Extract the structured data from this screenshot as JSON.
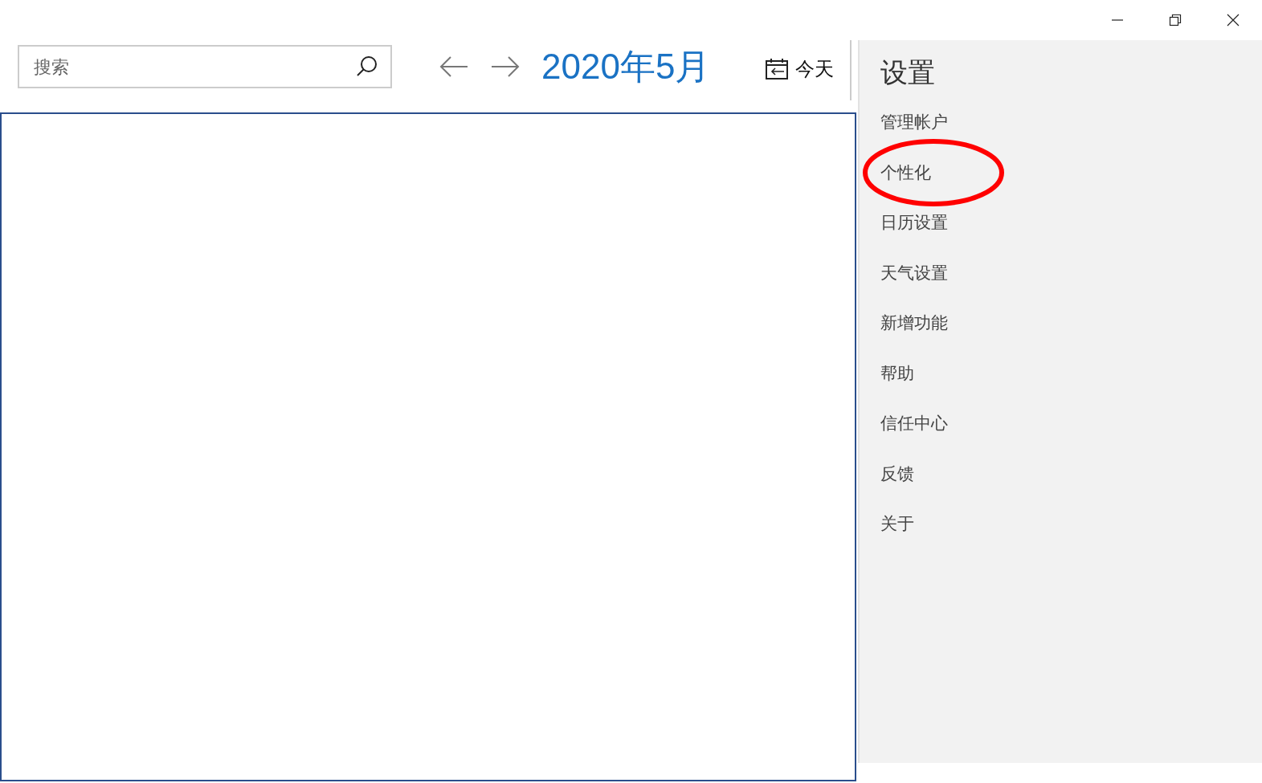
{
  "search": {
    "placeholder": "搜索"
  },
  "header": {
    "month": "2020年5月",
    "today": "今天"
  },
  "settings": {
    "title": "设置",
    "items": [
      {
        "label": "管理帐户",
        "circled": false
      },
      {
        "label": "个性化",
        "circled": true
      },
      {
        "label": "日历设置",
        "circled": false
      },
      {
        "label": "天气设置",
        "circled": false
      },
      {
        "label": "新增功能",
        "circled": false
      },
      {
        "label": "帮助",
        "circled": false
      },
      {
        "label": "信任中心",
        "circled": false
      },
      {
        "label": "反馈",
        "circled": false
      },
      {
        "label": "关于",
        "circled": false
      }
    ]
  }
}
